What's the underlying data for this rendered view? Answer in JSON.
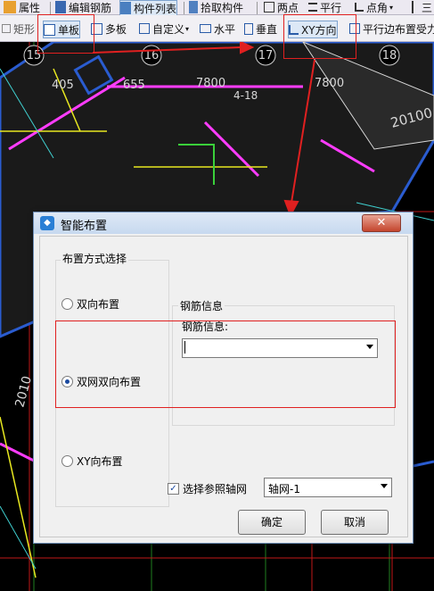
{
  "toolbar1": {
    "items": [
      "属性",
      "编辑钢筋",
      "构件列表",
      "拾取构件",
      "两点",
      "平行",
      "点角",
      "三"
    ]
  },
  "toolbar2": {
    "items": [
      "矩形",
      "单板",
      "多板",
      "自定义",
      "水平",
      "垂直",
      "XY方向",
      "平行边布置受力"
    ]
  },
  "canvas": {
    "axis_labels": [
      "15",
      "16",
      "17",
      "18"
    ],
    "dimensions": [
      "405",
      "655",
      "7800",
      "7800",
      "4-18"
    ],
    "side_labels": [
      "20100",
      "2010"
    ]
  },
  "dialog": {
    "title": "智能布置",
    "close": "✕",
    "layout_group_label": "布置方式选择",
    "options": [
      "双向布置",
      "双网双向布置",
      "XY向布置"
    ],
    "selected_option": "双网双向布置",
    "rebar_group_label": "钢筋信息",
    "rebar_field_label": "钢筋信息:",
    "rebar_value": "",
    "axis_checkbox_label": "选择参照轴网",
    "axis_checked": true,
    "axis_value": "轴网-1",
    "ok": "确定",
    "cancel": "取消"
  },
  "colors": {
    "canvas_bg": "#000000",
    "annotation_red": "#e02020",
    "dialog_bg": "#f0f0f0",
    "close_red": "#c4452d"
  }
}
